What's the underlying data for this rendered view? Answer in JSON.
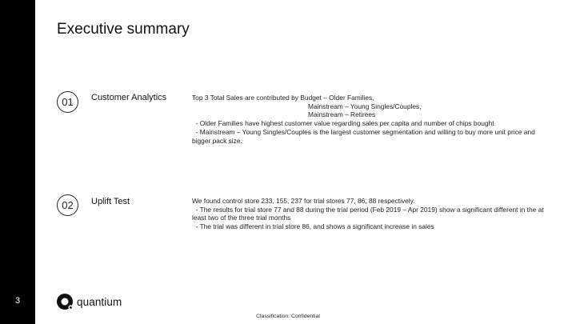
{
  "slide": {
    "number": "3",
    "title": "Executive summary",
    "classification": "Classification: Confidential"
  },
  "brand": {
    "name": "quantium",
    "logo_icon": "quantium-logo-icon"
  },
  "sections": [
    {
      "number": "01",
      "title": "Customer Analytics",
      "lines": [
        "Top 3 Total Sales are contributed by Budget – Older Families,",
        "Mainstream – Young Singles/Couples,",
        "Mainstream – Retirees",
        "  - Older Families have highest customer value regarding sales per capita and number of chips bought",
        "  - Mainstream – Young Singles/Couples is the largest customer segmentation and willing to buy more unit price and bigger pack size."
      ]
    },
    {
      "number": "02",
      "title": "Uplift Test",
      "lines": [
        "We found control store 233, 155, 237 for trial stores 77, 86, 88 respectively.",
        "  - The results for trial store 77 and 88 during the trial period (Feb 2019 – Apr 2019) show a significant different in the at least two of the three trial months",
        "  - The trial was different in trial store 86, and shows a significant increase in sales"
      ]
    }
  ]
}
